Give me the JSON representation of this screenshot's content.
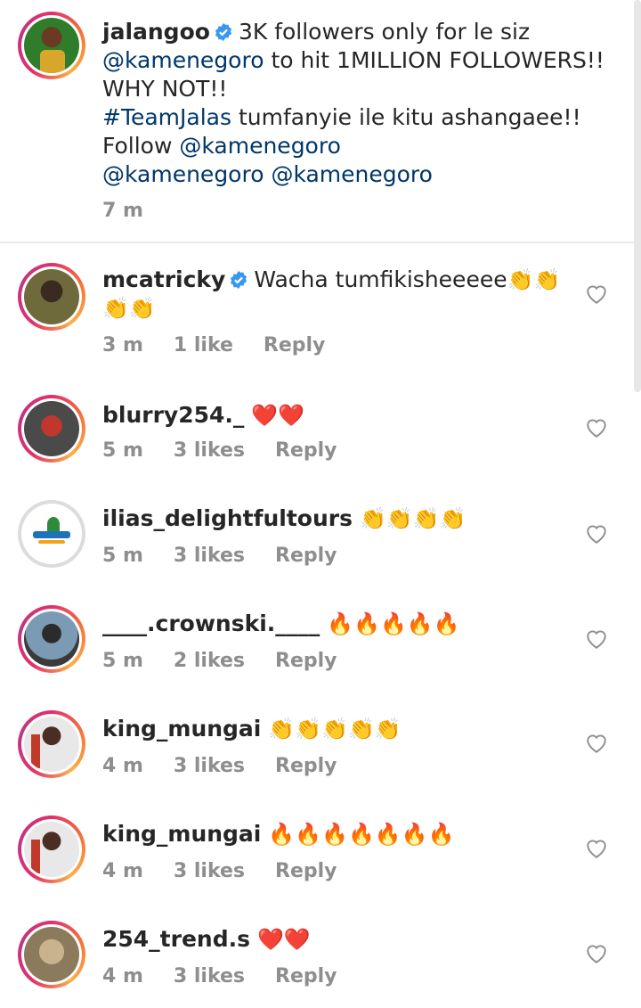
{
  "caption": {
    "username": "jalangoo",
    "lines": [
      "3K followers only for le siz",
      "to hit 1MILLION FOLLOWERS!!",
      "WHY NOT!!",
      "tumfanyie ile kitu ashangaee!!",
      "Follow"
    ],
    "mention": "@kamenegoro",
    "hashtag": "#TeamJalas",
    "mentions_line": "@kamenegoro @kamenegoro",
    "time": "7 m"
  },
  "comments": [
    {
      "username": "mcatricky",
      "verified": true,
      "text": "Wacha tumfikisheeeee",
      "emoji": "👏👏👏👏",
      "time": "3 m",
      "likes": "1 like",
      "reply": "Reply"
    },
    {
      "username": "blurry254._",
      "verified": false,
      "text": "",
      "emoji": "❤️❤️",
      "time": "5 m",
      "likes": "3 likes",
      "reply": "Reply"
    },
    {
      "username": "ilias_delightfultours",
      "verified": false,
      "text": "",
      "emoji": "👏👏👏👏",
      "time": "5 m",
      "likes": "3 likes",
      "reply": "Reply"
    },
    {
      "username": "____.crownski.____",
      "verified": false,
      "text": "",
      "emoji": "🔥🔥🔥🔥🔥",
      "time": "5 m",
      "likes": "2 likes",
      "reply": "Reply"
    },
    {
      "username": "king_mungai",
      "verified": false,
      "text": "",
      "emoji": "👏👏👏👏👏",
      "time": "4 m",
      "likes": "3 likes",
      "reply": "Reply"
    },
    {
      "username": "king_mungai",
      "verified": false,
      "text": "",
      "emoji": "🔥🔥🔥🔥🔥🔥🔥",
      "time": "4 m",
      "likes": "3 likes",
      "reply": "Reply"
    },
    {
      "username": "254_trend.s",
      "verified": false,
      "text": "",
      "emoji": "❤️❤️",
      "time": "4 m",
      "likes": "3 likes",
      "reply": "Reply"
    }
  ],
  "colors": {
    "link": "#00376b",
    "meta": "#8e8e8e",
    "verified": "#3897f0"
  }
}
